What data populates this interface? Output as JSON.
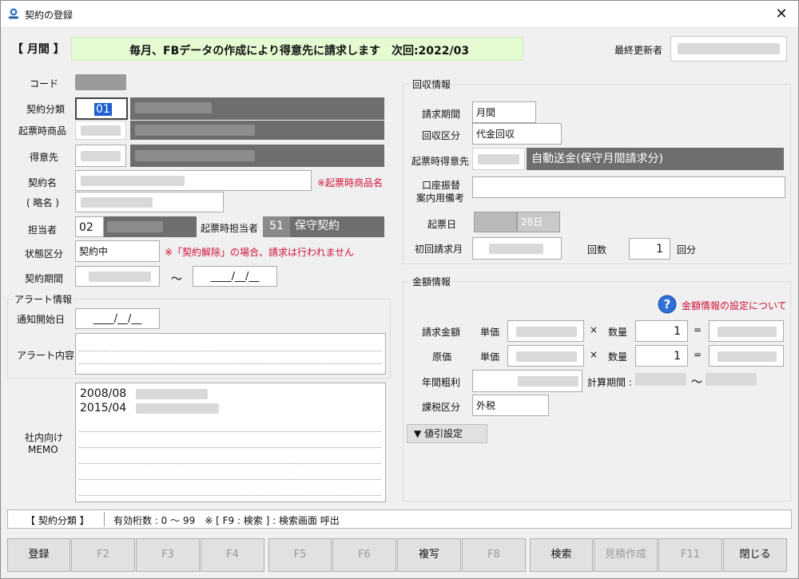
{
  "window": {
    "title": "契約の登録",
    "close_glyph": "✕"
  },
  "header": {
    "cycle": "【 月間 】",
    "banner": "毎月、FBデータの作成により得意先に請求します　次回:2022/03",
    "last_updater_label": "最終更新者",
    "banner_color": "#e5fbd2"
  },
  "left": {
    "code_label": "コード",
    "contract_type_label": "契約分類",
    "contract_type_code": "01",
    "slip_product_label": "起票時商品",
    "customer_label": "得意先",
    "contract_name_label": "契約名",
    "contract_name_note": "※起票時商品名",
    "short_name_label": "( 略名 )",
    "manager_label": "担当者",
    "manager_code": "02",
    "slip_manager_label": "起票時担当者",
    "slip_manager_code": "51",
    "slip_manager_name": "保守契約",
    "status_label": "状態区分",
    "status_value": "契約中",
    "status_note": "※「契約解除」の場合、請求は行われません",
    "period_label": "契約期間",
    "period_tilde": "～",
    "period_end": "____/__/__"
  },
  "alert": {
    "group_title": "アラート情報",
    "start_label": "通知開始日",
    "start_value": "____/__/__",
    "content_label": "アラート内容"
  },
  "memo": {
    "label_line1": "社内向け",
    "label_line2": "MEMO",
    "lines": [
      "2008/08",
      "2015/04"
    ]
  },
  "collection": {
    "group_title": "回収情報",
    "billing_period_label": "請求期間",
    "billing_period_value": "月間",
    "collection_type_label": "回収区分",
    "collection_type_value": "代金回収",
    "slip_customer_label": "起票時得意先",
    "slip_customer_value": "自動送金(保守月間請求分)",
    "transfer_label_line1": "口座振替",
    "transfer_label_line2": "案内用備考",
    "slip_date_label": "起票日",
    "slip_date_value": "28日",
    "first_billing_label": "初回請求月",
    "count_label": "回数",
    "count_value": "1",
    "count_unit": "回分"
  },
  "amount": {
    "group_title": "金額情報",
    "help_text": "金額情報の設定について",
    "billing_amount_label": "請求金額",
    "cost_label": "原価",
    "unit_price_label": "単価",
    "times": "×",
    "quantity_label": "数量",
    "billing_quantity": "1",
    "cost_quantity": "1",
    "equals": "=",
    "annual_profit_label": "年間粗利",
    "calc_period_label": "計算期間 :",
    "calc_tilde": "～",
    "tax_label": "課税区分",
    "tax_value": "外税",
    "discount_button": "▼ 値引設定"
  },
  "status_bar": {
    "field": "【 契約分類 】",
    "hint": "有効桁数 : 0 ～ 99　※ [ F9 : 検索 ] : 検索画面 呼出"
  },
  "fkeys": [
    {
      "label": "登録",
      "enabled": true
    },
    {
      "label": "F2",
      "enabled": false
    },
    {
      "label": "F3",
      "enabled": false
    },
    {
      "label": "F4",
      "enabled": false
    },
    {
      "label": "F5",
      "enabled": false
    },
    {
      "label": "F6",
      "enabled": false
    },
    {
      "label": "複写",
      "enabled": true
    },
    {
      "label": "F8",
      "enabled": false
    },
    {
      "label": "検索",
      "enabled": true
    },
    {
      "label": "見積作成",
      "enabled": false
    },
    {
      "label": "F11",
      "enabled": false
    },
    {
      "label": "閉じる",
      "enabled": true
    }
  ]
}
